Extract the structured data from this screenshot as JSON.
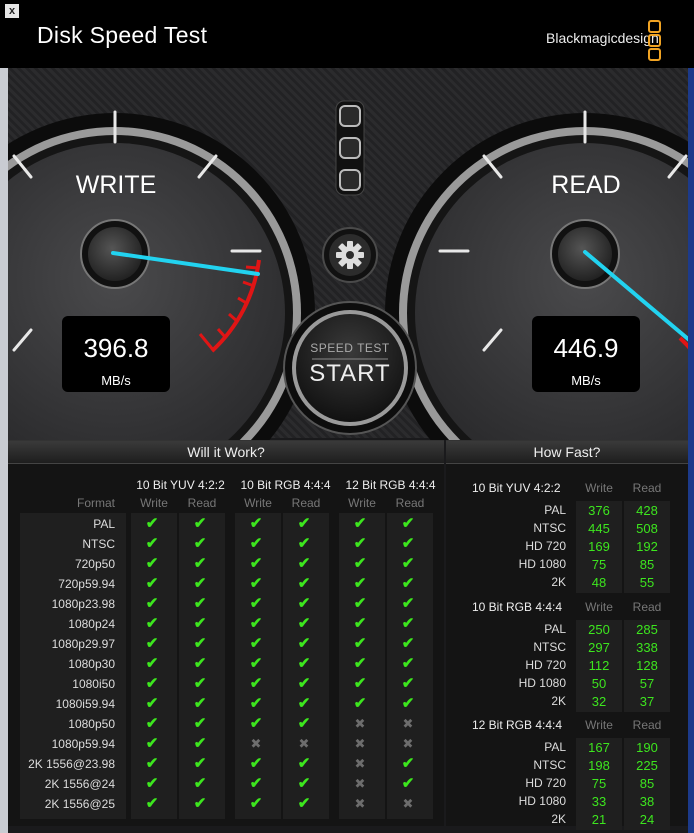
{
  "window": {
    "title": "Disk Speed Test",
    "close_label": "x",
    "brand": "Blackmagicdesign"
  },
  "gauges": {
    "write": {
      "label": "WRITE",
      "value": "396.8",
      "unit": "MB/s"
    },
    "read": {
      "label": "READ",
      "value": "446.9",
      "unit": "MB/s"
    }
  },
  "start": {
    "top_label": "SPEED TEST",
    "label": "START"
  },
  "will_it_work": {
    "title": "Will it Work?",
    "format_header": "Format",
    "groups": [
      {
        "name": "10 Bit YUV 4:2:2",
        "write": "Write",
        "read": "Read"
      },
      {
        "name": "10 Bit RGB 4:4:4",
        "write": "Write",
        "read": "Read"
      },
      {
        "name": "12 Bit RGB 4:4:4",
        "write": "Write",
        "read": "Read"
      }
    ],
    "rows": [
      {
        "format": "PAL",
        "marks": [
          1,
          1,
          1,
          1,
          1,
          1
        ]
      },
      {
        "format": "NTSC",
        "marks": [
          1,
          1,
          1,
          1,
          1,
          1
        ]
      },
      {
        "format": "720p50",
        "marks": [
          1,
          1,
          1,
          1,
          1,
          1
        ]
      },
      {
        "format": "720p59.94",
        "marks": [
          1,
          1,
          1,
          1,
          1,
          1
        ]
      },
      {
        "format": "1080p23.98",
        "marks": [
          1,
          1,
          1,
          1,
          1,
          1
        ]
      },
      {
        "format": "1080p24",
        "marks": [
          1,
          1,
          1,
          1,
          1,
          1
        ]
      },
      {
        "format": "1080p29.97",
        "marks": [
          1,
          1,
          1,
          1,
          1,
          1
        ]
      },
      {
        "format": "1080p30",
        "marks": [
          1,
          1,
          1,
          1,
          1,
          1
        ]
      },
      {
        "format": "1080i50",
        "marks": [
          1,
          1,
          1,
          1,
          1,
          1
        ]
      },
      {
        "format": "1080i59.94",
        "marks": [
          1,
          1,
          1,
          1,
          1,
          1
        ]
      },
      {
        "format": "1080p50",
        "marks": [
          1,
          1,
          1,
          1,
          0,
          0
        ]
      },
      {
        "format": "1080p59.94",
        "marks": [
          1,
          1,
          0,
          0,
          0,
          0
        ]
      },
      {
        "format": "2K 1556@23.98",
        "marks": [
          1,
          1,
          1,
          1,
          0,
          1
        ]
      },
      {
        "format": "2K 1556@24",
        "marks": [
          1,
          1,
          1,
          1,
          0,
          1
        ]
      },
      {
        "format": "2K 1556@25",
        "marks": [
          1,
          1,
          1,
          1,
          0,
          0
        ]
      }
    ]
  },
  "how_fast": {
    "title": "How Fast?",
    "groups": [
      {
        "name": "10 Bit YUV 4:2:2",
        "write": "Write",
        "read": "Read",
        "rows": [
          {
            "label": "PAL",
            "write": "376",
            "read": "428"
          },
          {
            "label": "NTSC",
            "write": "445",
            "read": "508"
          },
          {
            "label": "HD 720",
            "write": "169",
            "read": "192"
          },
          {
            "label": "HD 1080",
            "write": "75",
            "read": "85"
          },
          {
            "label": "2K",
            "write": "48",
            "read": "55"
          }
        ]
      },
      {
        "name": "10 Bit RGB 4:4:4",
        "write": "Write",
        "read": "Read",
        "rows": [
          {
            "label": "PAL",
            "write": "250",
            "read": "285"
          },
          {
            "label": "NTSC",
            "write": "297",
            "read": "338"
          },
          {
            "label": "HD 720",
            "write": "112",
            "read": "128"
          },
          {
            "label": "HD 1080",
            "write": "50",
            "read": "57"
          },
          {
            "label": "2K",
            "write": "32",
            "read": "37"
          }
        ]
      },
      {
        "name": "12 Bit RGB 4:4:4",
        "write": "Write",
        "read": "Read",
        "rows": [
          {
            "label": "PAL",
            "write": "167",
            "read": "190"
          },
          {
            "label": "NTSC",
            "write": "198",
            "read": "225"
          },
          {
            "label": "HD 720",
            "write": "75",
            "read": "85"
          },
          {
            "label": "HD 1080",
            "write": "33",
            "read": "38"
          },
          {
            "label": "2K",
            "write": "21",
            "read": "24"
          }
        ]
      }
    ]
  },
  "icons": {
    "check": "check-icon",
    "cross": "cross-icon",
    "settings": "gear-icon",
    "close": "close-icon"
  },
  "colors": {
    "accent_green": "#3de61e",
    "needle": "#22d3f0",
    "redzone": "#e01515",
    "brand_orange": "#f0a323"
  }
}
